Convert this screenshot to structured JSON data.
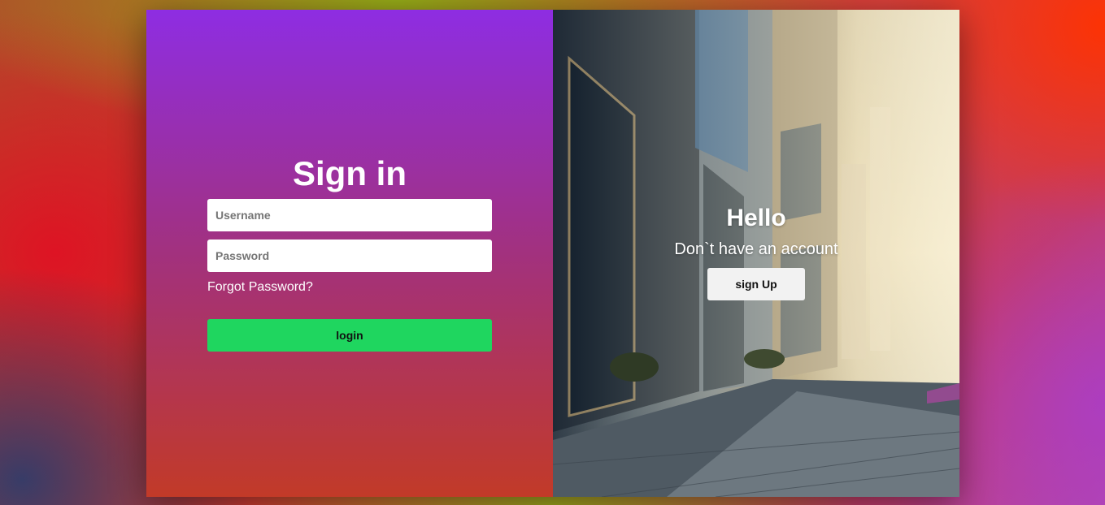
{
  "signin": {
    "title": "Sign in",
    "username_placeholder": "Username",
    "password_placeholder": "Password",
    "forgot_label": "Forgot Password?",
    "login_label": "login"
  },
  "signup_panel": {
    "title": "Hello",
    "subtitle": "Don`t have an account",
    "signup_label": "sign Up",
    "background_image": "city-street-buildings-photo"
  },
  "colors": {
    "left_gradient_top": "#8e2de2",
    "left_gradient_bottom": "#c23a28",
    "login_button": "#1fd65f",
    "signup_button": "#f2f2f2"
  }
}
